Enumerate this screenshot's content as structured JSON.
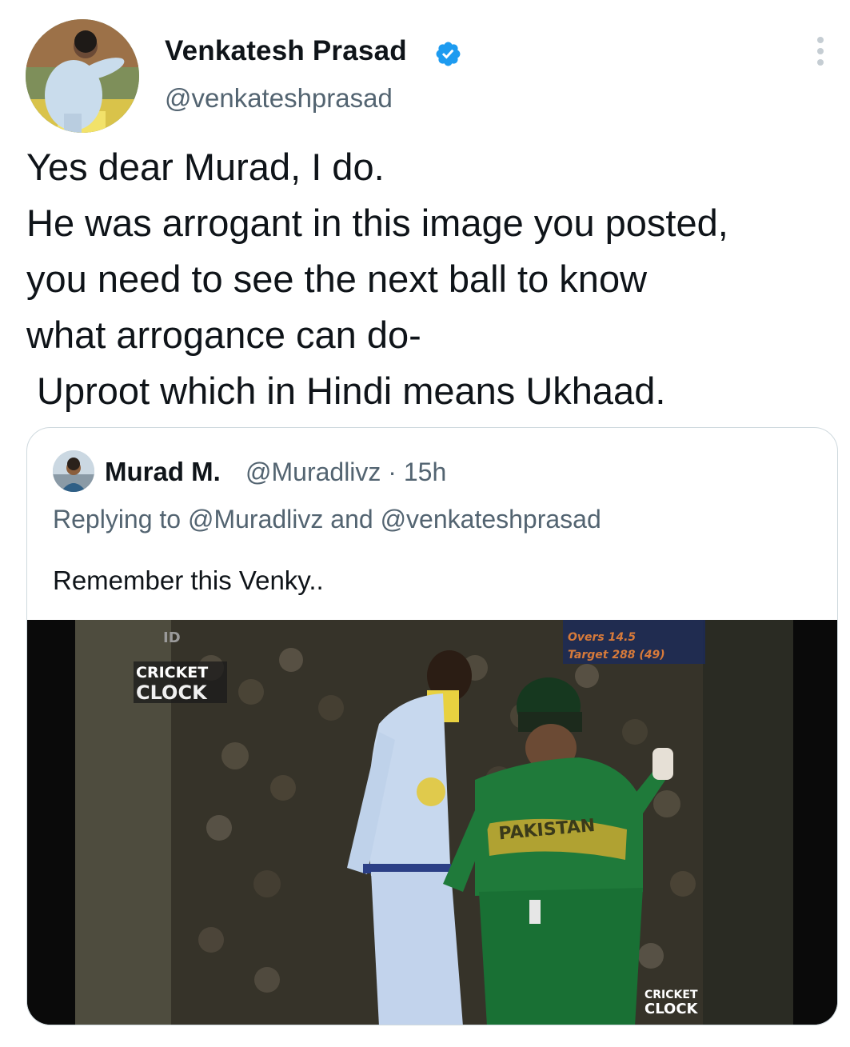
{
  "author": {
    "name": "Venkatesh Prasad",
    "handle": "@venkateshprasad",
    "verified": true,
    "avatar_icon": "cricketer-avatar"
  },
  "tweet": {
    "lines": [
      "Yes dear Murad, I do.",
      "He was arrogant in this image you posted,",
      "you need to see the next ball to know",
      "what arrogance can do-",
      " Uproot which in Hindi means Ukhaad."
    ]
  },
  "quoted_tweet": {
    "name": "Murad M.",
    "handle_time": "@Muradlivz · 15h",
    "replying_to": "Replying to @Muradlivz and @venkateshprasad",
    "text": "Remember this Venky..",
    "media": {
      "logo_top_line1": "CRICKET",
      "logo_top_line2": "CLOCK",
      "logo_bottom_line1": "CRICKET",
      "logo_bottom_line2": "CLOCK",
      "score_overs": "Overs 14.5",
      "score_target": "Target 288 (49)",
      "corner_label": "ID",
      "jersey_text": "PAKISTAN"
    }
  },
  "colors": {
    "verified_blue": "#1d9bf0",
    "secondary_text": "#536471",
    "border": "#cfd9de"
  }
}
